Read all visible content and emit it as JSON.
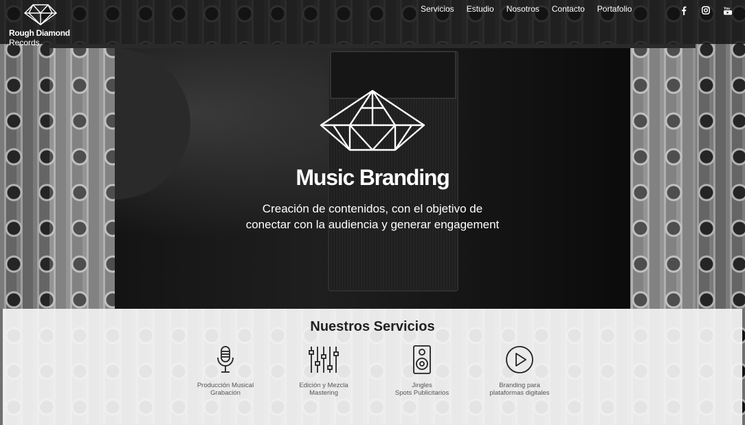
{
  "brand": {
    "name": "Rough Diamond",
    "sub": "Records"
  },
  "nav": [
    "Servicios",
    "Estudio",
    "Nosotros",
    "Contacto",
    "Portafolio"
  ],
  "socials": [
    "facebook-icon",
    "instagram-icon",
    "youtube-icon"
  ],
  "hero": {
    "title": "Music Branding",
    "subtitle_line1": "Creación de contenidos, con el objetivo de",
    "subtitle_line2": "conectar con la audiencia y generar engagement"
  },
  "services": {
    "title": "Nuestros Servicios",
    "items": [
      {
        "icon": "microphone-icon",
        "line1": "Producción Musical",
        "line2": "Grabación"
      },
      {
        "icon": "mixer-sliders-icon",
        "line1": "Edición y Mezcla",
        "line2": "Mastering"
      },
      {
        "icon": "speaker-icon",
        "line1": "Jingles",
        "line2": "Spots Publicitarios"
      },
      {
        "icon": "play-circle-icon",
        "line1": "Branding para",
        "line2": "plataformas digitales"
      }
    ]
  }
}
